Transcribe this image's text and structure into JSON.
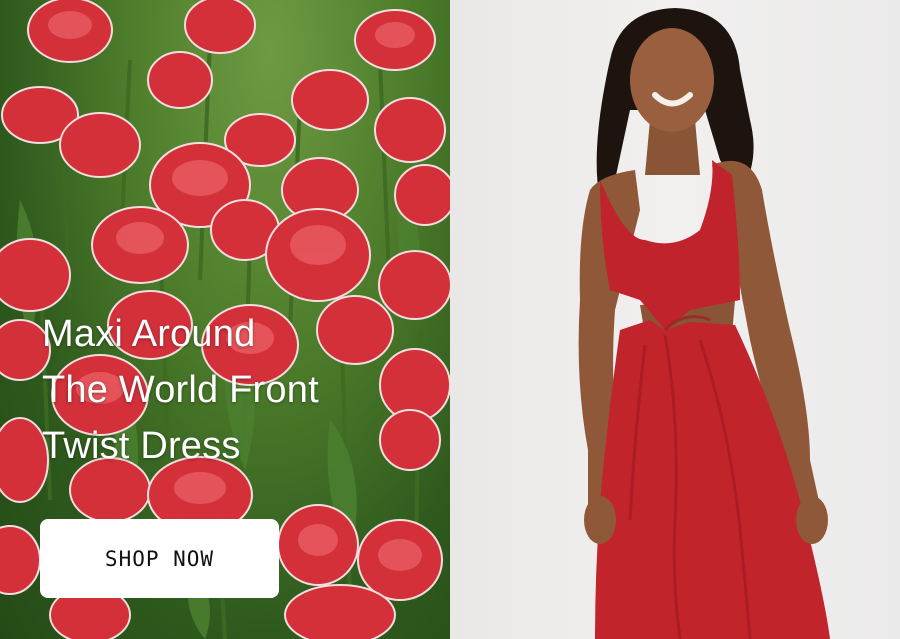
{
  "promo": {
    "headline_lines": [
      "Maxi Around",
      "The World Front",
      "Twist Dress"
    ],
    "cta_label": "SHOP NOW"
  },
  "colors": {
    "tulip_red": "#d8323a",
    "dress_red": "#c0232b",
    "foliage_green": "#3f6f26",
    "backdrop_gray": "#ececec",
    "button_bg": "#ffffff"
  },
  "images": {
    "left": "tulip-field-photo",
    "right": "model-in-red-twist-dress-photo"
  }
}
